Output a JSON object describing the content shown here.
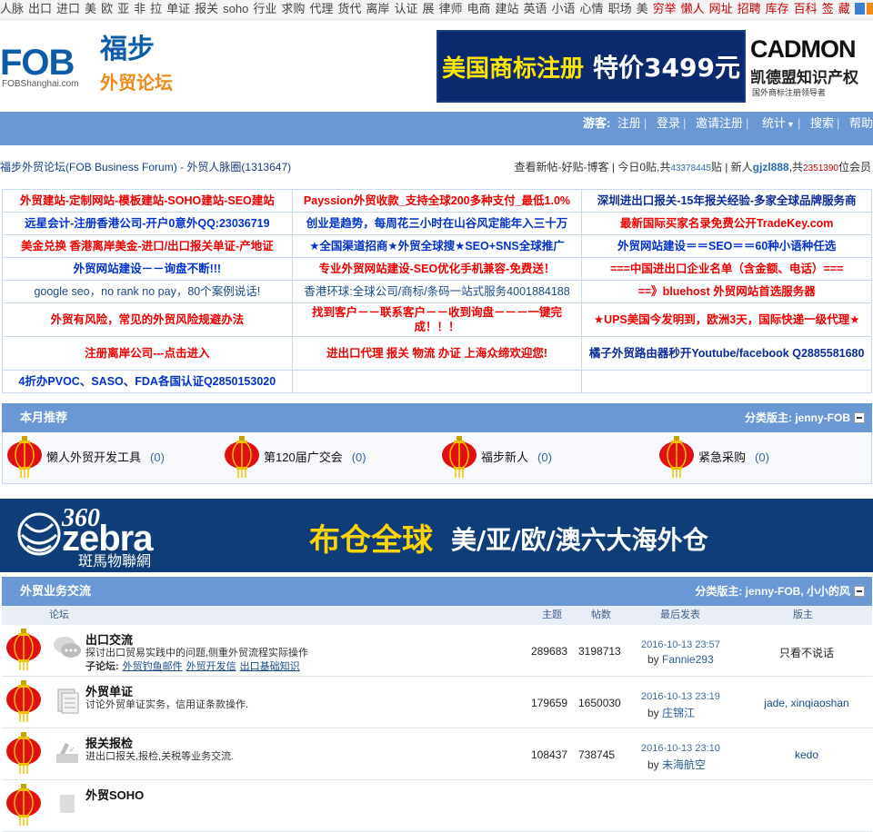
{
  "topnav": {
    "links": [
      "人脉",
      "出口",
      "进口",
      "美",
      "欧",
      "亚",
      "非",
      "拉",
      "单证",
      "报关",
      "soho",
      "行业",
      "求购",
      "代理",
      "货代",
      "离岸",
      "认证",
      "展",
      "律师",
      "电商",
      "建站",
      "英语",
      "小语",
      "心情",
      "职场",
      "美"
    ],
    "red_links": [
      "穷举",
      "懒人",
      "网址",
      "招聘",
      "库存",
      "百科",
      "签",
      "藏"
    ]
  },
  "logo": {
    "text": "FOB",
    "url": "FOBShanghai.com",
    "cn_title": "福步",
    "cn_sub": "外贸论坛"
  },
  "ad_banner": {
    "main": "美国商标注册",
    "price": "特价3499元",
    "brand": "CADMON",
    "brand_cn": "凯德盟知识产权",
    "slogan": "国外商标注册领导者"
  },
  "navbar": {
    "guest": "游客:",
    "register": "注册",
    "login": "登录",
    "invite": "邀请注册",
    "stats": "统计",
    "search": "搜索",
    "help": "帮助"
  },
  "infobar": {
    "forum_title": "福步外贸论坛(FOB Business Forum)",
    "circle": "外贸人脉圈",
    "circle_count": "(1313647)",
    "view_links": "查看新帖-好贴-博客",
    "today_label": "今日0贴,共",
    "total_posts": "43378445",
    "post_unit": "贴",
    "newbie_label": "新人",
    "newbie_name": "gjzl888",
    "member_prefix": ",共",
    "members": "2351390",
    "member_unit": "位会员"
  },
  "ads": [
    [
      "外贸建站-定制网站-模板建站-SOHO建站-SEO建站",
      "Payssion外贸收款_支持全球200多种支付_最低1.0%",
      "深圳进出口报关-15年报关经验-多家全球品牌服务商"
    ],
    [
      "远星会计-注册香港公司-开户0意外QQ:23036719",
      "创业是趋势，每周花三小时在山谷风定能年入三十万",
      "最新国际买家名录免费公开TradeKey.com"
    ],
    [
      "美金兑换 香港离岸美金-进口/出口报关单证-产地证",
      "★全国渠道招商★外贸全球搜★SEO+SNS全球推广",
      "外贸网站建设＝＝SEO＝＝60种小语种任选"
    ],
    [
      "外贸网站建设－－询盘不断!!!",
      "专业外贸网站建设-SEO优化手机兼容-免费送！",
      "===中国进出口企业名单（含金额、电话）==="
    ],
    [
      "google seo，no rank no pay，80个案例说话!",
      "香港环球:全球公司/商标/条码一站式服务4001884188",
      "==》bluehost 外贸网站首选服务器"
    ],
    [
      "外贸有风险，常见的外贸风险规避办法",
      "找到客户－－联系客户－－收到询盘－－－一键完成！！！",
      "★UPS美国今发明到，欧洲3天，国际快递一级代理★"
    ],
    [
      "注册离岸公司---点击进入",
      "进出口代理 报关 物流 办证 上海众缔欢迎您!",
      "橘子外贸路由器秒开Youtube/facebook Q2885581680"
    ],
    [
      "4折办PVOC、SASO、FDA各国认证Q2850153020",
      "",
      ""
    ]
  ],
  "monthly": {
    "title": "本月推荐",
    "moderator": "分类版主: jenny-FOB",
    "items": [
      {
        "label": "懒人外贸开发工具",
        "count": "(0)"
      },
      {
        "label": "第120届广交会",
        "count": "(0)"
      },
      {
        "label": "福步新人",
        "count": "(0)"
      },
      {
        "label": "紧急采购",
        "count": "(0)"
      }
    ]
  },
  "banner2": {
    "logo_num": "360",
    "logo_word": "zebra",
    "logo_cn": "斑馬物聯網",
    "slogan1": "布仓全球",
    "slogan2": "美/亚/欧/澳六大海外仓"
  },
  "forum_section": {
    "title": "外贸业务交流",
    "moderator": "分类版主: jenny-FOB, 小小的风",
    "columns": {
      "forum": "论坛",
      "topics": "主题",
      "posts": "帖数",
      "last": "最后发表",
      "mod": "版主"
    },
    "rows": [
      {
        "title": "出口交流",
        "desc": "探讨出口贸易实践中的问题,侧重外贸流程实际操作",
        "sub_label": "子论坛:",
        "subs": [
          "外贸钓鱼邮件",
          "外贸开发信",
          "出口基础知识"
        ],
        "topics": "289683",
        "posts": "3198713",
        "date": "2016-10-13 23:57",
        "by": "by",
        "user": "Fannie293",
        "mod": "只看不说话"
      },
      {
        "title": "外贸单证",
        "desc": "讨论外贸单证实务，信用证条款操作.",
        "sub_label": "",
        "subs": [],
        "topics": "179659",
        "posts": "1650030",
        "date": "2016-10-13 23:19",
        "by": "by",
        "user": "庄锦江",
        "mod": "jade, xinqiaoshan"
      },
      {
        "title": "报关报检",
        "desc": "进出口报关,报检,关税等业务交流.",
        "sub_label": "",
        "subs": [],
        "topics": "108437",
        "posts": "738745",
        "date": "2016-10-13 23:10",
        "by": "by",
        "user": "未海航空",
        "mod": "kedo"
      },
      {
        "title": "外贸SOHO",
        "desc": "",
        "sub_label": "",
        "subs": [],
        "topics": "",
        "posts": "",
        "date": "",
        "by": "",
        "user": "",
        "mod": ""
      }
    ]
  },
  "colors": {
    "nav_blue": "#6a98d5",
    "ad_red": "#e00",
    "ad_blue": "#0033cc",
    "brand_orange": "#f08a16",
    "brand_blue": "#0e5ca8"
  }
}
